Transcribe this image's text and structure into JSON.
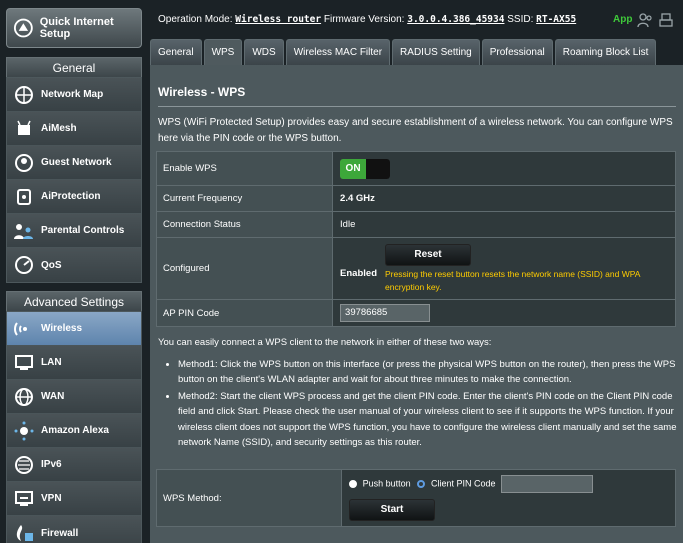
{
  "sidebar": {
    "quick_setup": "Quick Internet Setup",
    "general_header": "General",
    "general_items": [
      {
        "label": "Network Map",
        "icon": "network-map-icon"
      },
      {
        "label": "AiMesh",
        "icon": "aimesh-icon"
      },
      {
        "label": "Guest Network",
        "icon": "guest-network-icon"
      },
      {
        "label": "AiProtection",
        "icon": "aiprotection-icon"
      },
      {
        "label": "Parental Controls",
        "icon": "parental-controls-icon"
      },
      {
        "label": "QoS",
        "icon": "qos-icon"
      }
    ],
    "advanced_header": "Advanced Settings",
    "advanced_items": [
      {
        "label": "Wireless",
        "icon": "wireless-icon",
        "active": true
      },
      {
        "label": "LAN",
        "icon": "lan-icon"
      },
      {
        "label": "WAN",
        "icon": "wan-icon"
      },
      {
        "label": "Amazon Alexa",
        "icon": "alexa-icon"
      },
      {
        "label": "IPv6",
        "icon": "ipv6-icon"
      },
      {
        "label": "VPN",
        "icon": "vpn-icon"
      },
      {
        "label": "Firewall",
        "icon": "firewall-icon"
      }
    ]
  },
  "topbar": {
    "op_mode_label": "Operation Mode:",
    "op_mode_value": "Wireless router",
    "firmware_label": "Firmware Version:",
    "firmware_value": "3.0.0.4.386_45934",
    "ssid_label": "SSID:",
    "ssid_value": "RT-AX55",
    "app_label": "App"
  },
  "tabs": [
    {
      "label": "General"
    },
    {
      "label": "WPS",
      "active": true
    },
    {
      "label": "WDS"
    },
    {
      "label": "Wireless MAC Filter"
    },
    {
      "label": "RADIUS Setting"
    },
    {
      "label": "Professional"
    },
    {
      "label": "Roaming Block List"
    }
  ],
  "page": {
    "title": "Wireless - WPS",
    "description": "WPS (WiFi Protected Setup) provides easy and secure establishment of a wireless network. You can configure WPS here via the PIN code or the WPS button."
  },
  "form": {
    "enable_wps_label": "Enable WPS",
    "enable_wps_value": "ON",
    "frequency_label": "Current Frequency",
    "frequency_value": "2.4 GHz",
    "connection_label": "Connection Status",
    "connection_value": "Idle",
    "configured_label": "Configured",
    "configured_value": "Enabled",
    "reset_button": "Reset",
    "reset_note": "Pressing the reset button resets the network name (SSID) and WPA encryption key.",
    "pin_label": "AP PIN Code",
    "pin_value": "39786685"
  },
  "methods": {
    "intro": "You can easily connect a WPS client to the network in either of these two ways:",
    "method1": "Method1: Click the WPS button on this interface (or press the physical WPS button on the router), then press the WPS button on the client's WLAN adapter and wait for about three minutes to make the connection.",
    "method2": "Method2: Start the client WPS process and get the client PIN code. Enter the client's PIN code on the Client PIN code field and click Start. Please check the user manual of your wireless client to see if it supports the WPS function. If your wireless client does not support the WPS function, you have to configure the wireless client manually and set the same network Name (SSID), and security settings as this router."
  },
  "wps_method": {
    "label": "WPS Method:",
    "push_button": "Push button",
    "client_pin": "Client PIN Code",
    "start_button": "Start"
  }
}
